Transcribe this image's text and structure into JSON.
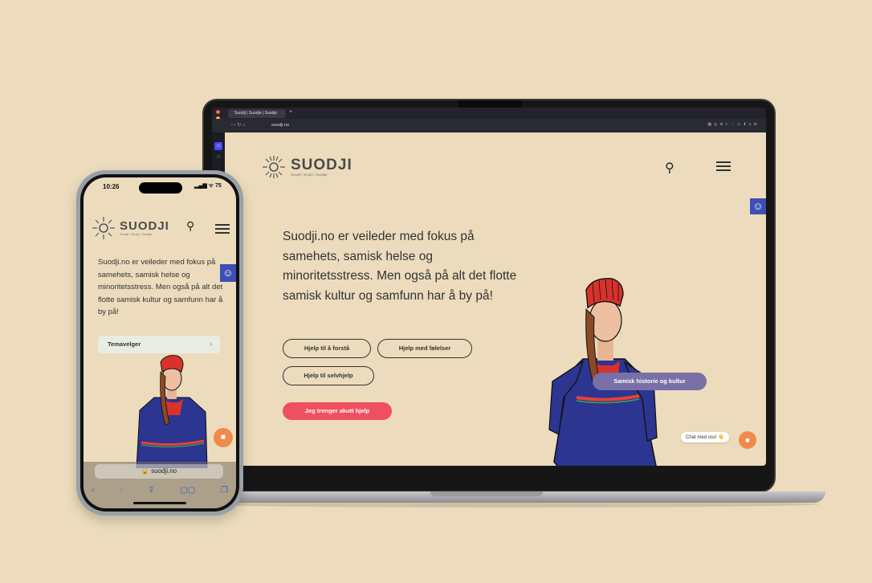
{
  "laptop": {
    "tab_title": "Suodji | Suodje | Suodje",
    "tab_plus": "+",
    "url": "suodji.no",
    "brand_name": "SUODJI",
    "brand_sub": "Suodji / Suoj̄o / Suodje",
    "hero_text": "Suodji.no er veileder med fokus på samehets, samisk helse og minoritetsstress. Men også på alt det flotte samisk kultur og samfunn har å by på!",
    "buttons": {
      "forsta": "Hjelp til å forstå",
      "folelser": "Hjelp med følelser",
      "selvhjelp": "Hjelp til selvhjelp"
    },
    "cta": "Jeg trenger akutt hjelp",
    "topic_pill": "Samisk historie og kultur",
    "chat_label": "Chat med oss! 👋"
  },
  "phone": {
    "time": "10:26",
    "status": "▂▄▆ ᯤ 75",
    "brand_name": "SUODJI",
    "brand_sub": "Suodji / Suoj̄o / Suodje",
    "hero_text": "Suodji.no er veileder med fokus på samehets, samisk helse og minoritetsstress. Men også på alt det flotte samisk kultur og samfunn har å by på!",
    "select_label": "Temavelger",
    "url": "suodji.no"
  },
  "colors": {
    "background": "#ecdcbd",
    "accent_blue": "#3d4fb5",
    "cta_red": "#ef4f5e",
    "pill_purple": "#7870a6",
    "chat_orange": "#f08a4b",
    "dress_blue": "#2c3590",
    "hat_red": "#d8322d"
  },
  "icons": {
    "search": "search-icon",
    "menu": "hamburger-menu-icon",
    "accessibility": "accessibility-icon",
    "chat": "chat-bubble-icon",
    "logo": "sun-logo-icon"
  }
}
